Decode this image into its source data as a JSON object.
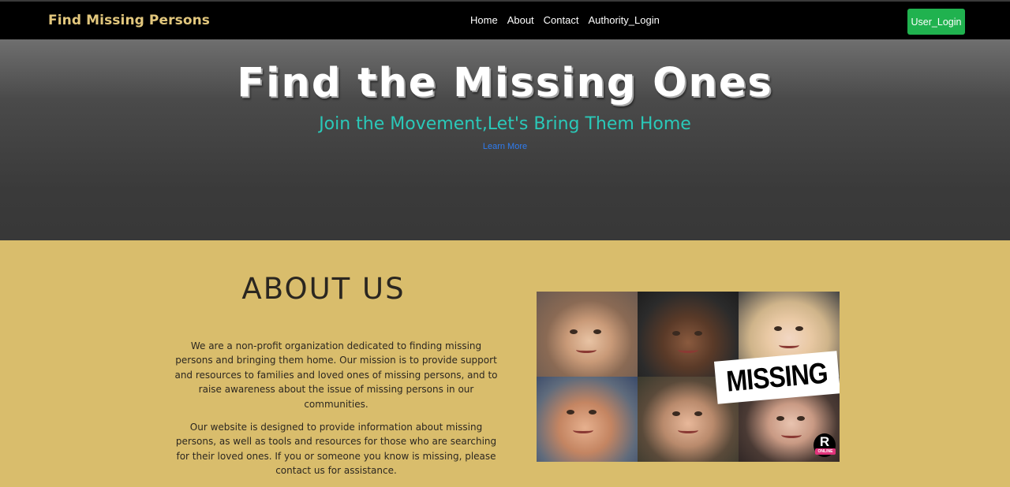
{
  "navbar": {
    "brand": "Find Missing Persons",
    "links": [
      "Home",
      "About",
      "Contact",
      "Authority_Login"
    ],
    "login_button": "User_Login",
    "login_button_color": "#20b24f",
    "brand_color": "#e2c77d"
  },
  "hero": {
    "title": "Find the Missing Ones",
    "subtitle": "Join the Movement,Let's Bring Them Home",
    "link": "Learn More",
    "subtitle_color": "#2ac9b9",
    "link_color": "#2e7cf0"
  },
  "about": {
    "heading": "ABOUT US",
    "paragraphs": [
      "We are a non-profit organization dedicated to finding missing persons and bringing them home. Our mission is to provide support and resources to families and loved ones of missing persons, and to raise awareness about the issue of missing persons in our communities.",
      "Our website is designed to provide information about missing persons, as well as tools and resources for those who are searching for their loved ones. If you or someone you know is missing, please contact us for assistance."
    ],
    "background_color": "#d9bd6c",
    "image": {
      "label": "MISSING",
      "badge_letter": "R",
      "badge_sub": "ONLINE"
    }
  }
}
